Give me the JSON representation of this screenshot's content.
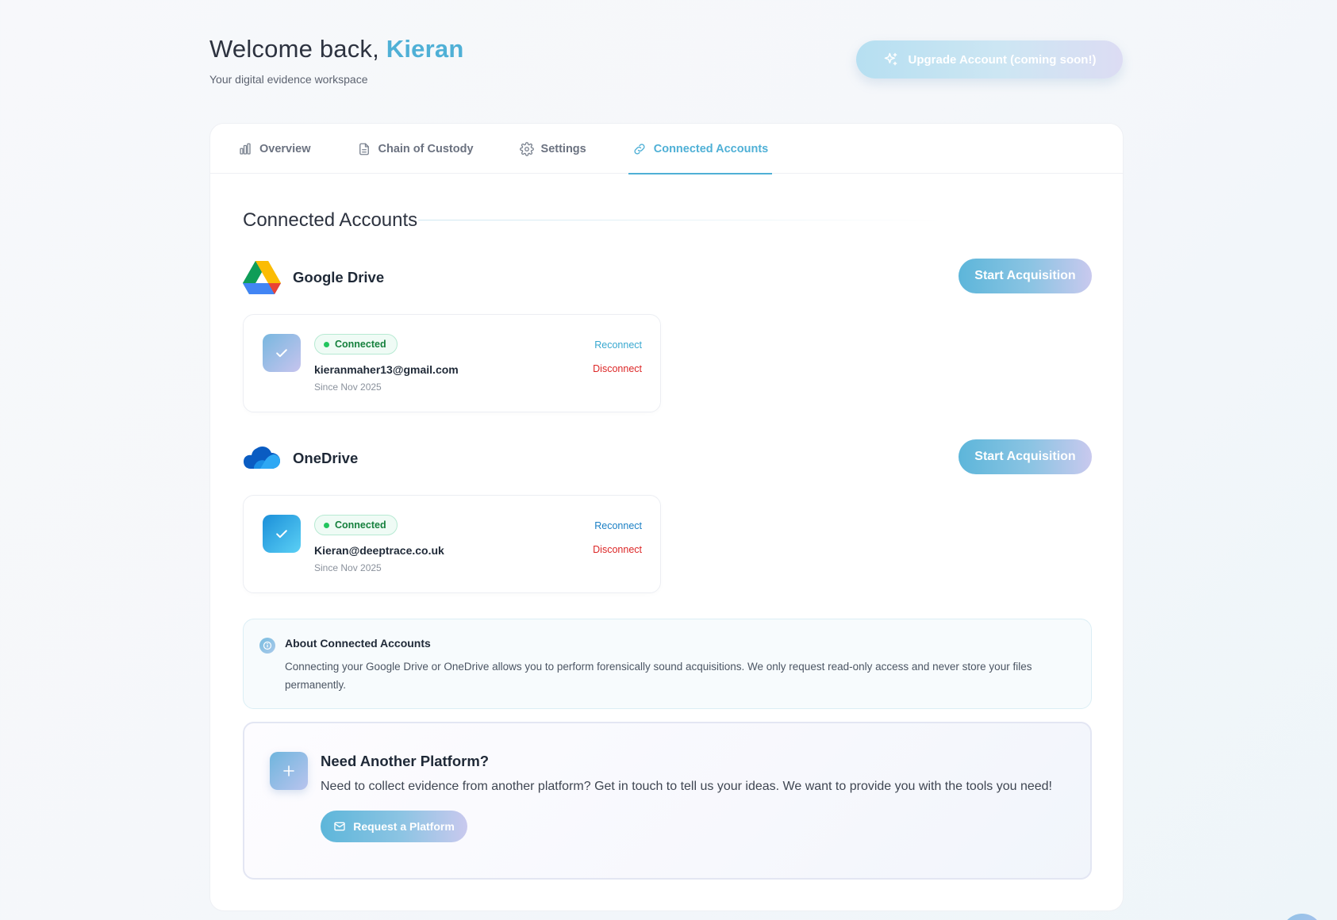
{
  "header": {
    "welcome_prefix": "Welcome back,",
    "user_name": "Kieran",
    "subtitle": "Your digital evidence workspace",
    "upgrade_label": "Upgrade Account (coming soon!)"
  },
  "tabs": [
    {
      "label": "Overview",
      "icon": "bar-chart-icon",
      "active": false
    },
    {
      "label": "Chain of Custody",
      "icon": "document-icon",
      "active": false
    },
    {
      "label": "Settings",
      "icon": "gear-icon",
      "active": false
    },
    {
      "label": "Connected Accounts",
      "icon": "link-icon",
      "active": true
    }
  ],
  "section_title": "Connected Accounts",
  "providers": [
    {
      "name": "Google Drive",
      "logo": "google-drive-logo",
      "action_label": "Start Acquisition",
      "account": {
        "status": "Connected",
        "email": "kieranmaher13@gmail.com",
        "since": "Since Nov 2025",
        "reconnect_label": "Reconnect",
        "disconnect_label": "Disconnect",
        "reconnect_color": "#38a8d0"
      }
    },
    {
      "name": "OneDrive",
      "logo": "onedrive-logo",
      "action_label": "Start Acquisition",
      "account": {
        "status": "Connected",
        "email": "Kieran@deeptrace.co.uk",
        "since": "Since Nov 2025",
        "reconnect_label": "Reconnect",
        "disconnect_label": "Disconnect",
        "reconnect_color": "#1a7fc4"
      }
    }
  ],
  "info": {
    "title": "About Connected Accounts",
    "text": "Connecting your Google Drive or OneDrive allows you to perform forensically sound acquisitions. We only request read-only access and never store your files permanently."
  },
  "need_platform": {
    "title": "Need Another Platform?",
    "text": "Need to collect evidence from another platform? Get in touch to tell us your ideas. We want to provide you with the tools you need!",
    "button_label": "Request a Platform"
  },
  "colors": {
    "accent": "#4fb0d6",
    "connected_green": "#22c55e",
    "disconnect_red": "#dc2626"
  }
}
